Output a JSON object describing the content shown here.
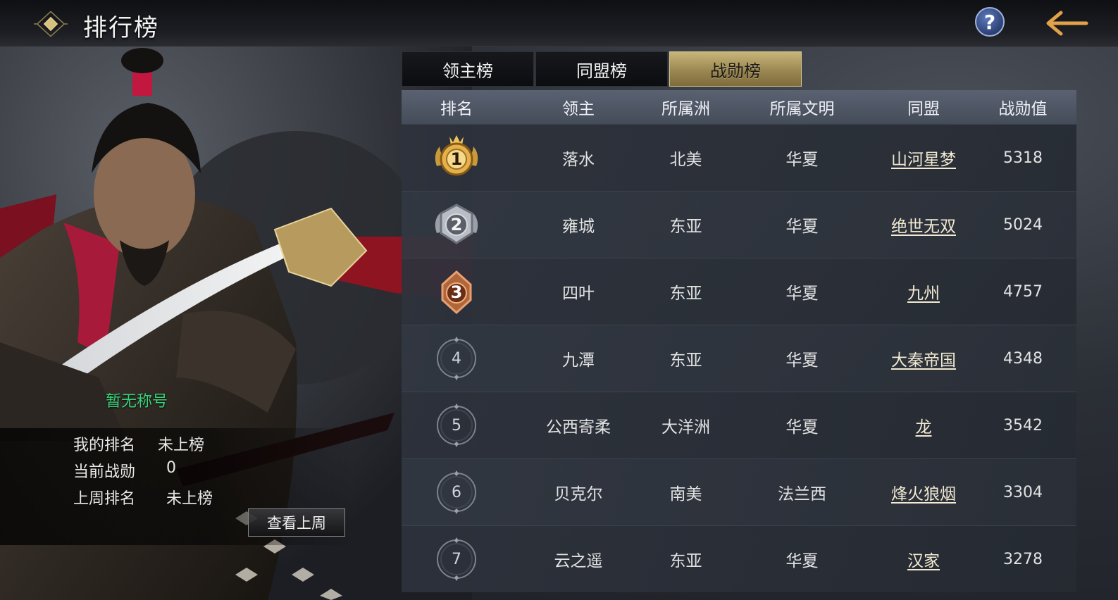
{
  "header": {
    "title": "排行榜",
    "help_icon": "question-icon",
    "back_icon": "back-arrow-icon"
  },
  "tabs": [
    {
      "label": "领主榜",
      "active": false
    },
    {
      "label": "同盟榜",
      "active": false
    },
    {
      "label": "战勋榜",
      "active": true
    }
  ],
  "table": {
    "columns": [
      "排名",
      "领主",
      "所属洲",
      "所属文明",
      "同盟",
      "战勋值"
    ],
    "rows": [
      {
        "rank": "1",
        "lord": "落水",
        "region": "北美",
        "civ": "华夏",
        "alliance": "山河星梦",
        "score": "5318"
      },
      {
        "rank": "2",
        "lord": "雍城",
        "region": "东亚",
        "civ": "华夏",
        "alliance": "绝世无双",
        "score": "5024"
      },
      {
        "rank": "3",
        "lord": "四叶",
        "region": "东亚",
        "civ": "华夏",
        "alliance": "九州",
        "score": "4757"
      },
      {
        "rank": "4",
        "lord": "九潭",
        "region": "东亚",
        "civ": "华夏",
        "alliance": "大秦帝国",
        "score": "4348"
      },
      {
        "rank": "5",
        "lord": "公西寄柔",
        "region": "大洋洲",
        "civ": "华夏",
        "alliance": "龙",
        "score": "3542"
      },
      {
        "rank": "6",
        "lord": "贝克尔",
        "region": "南美",
        "civ": "法兰西",
        "alliance": "烽火狼烟",
        "score": "3304"
      },
      {
        "rank": "7",
        "lord": "云之遥",
        "region": "东亚",
        "civ": "华夏",
        "alliance": "汉家",
        "score": "3278"
      }
    ]
  },
  "player": {
    "title_status": "暂无称号",
    "my_rank_label": "我的排名",
    "my_rank_value": "未上榜",
    "current_label": "当前战勋",
    "current_value": "0",
    "last_week_label": "上周排名",
    "last_week_value": "未上榜",
    "view_last_week_button": "查看上周"
  },
  "colors": {
    "accent_gold": "#c8b57a",
    "title_green": "#39d27a",
    "header_row": "#5a6272"
  }
}
